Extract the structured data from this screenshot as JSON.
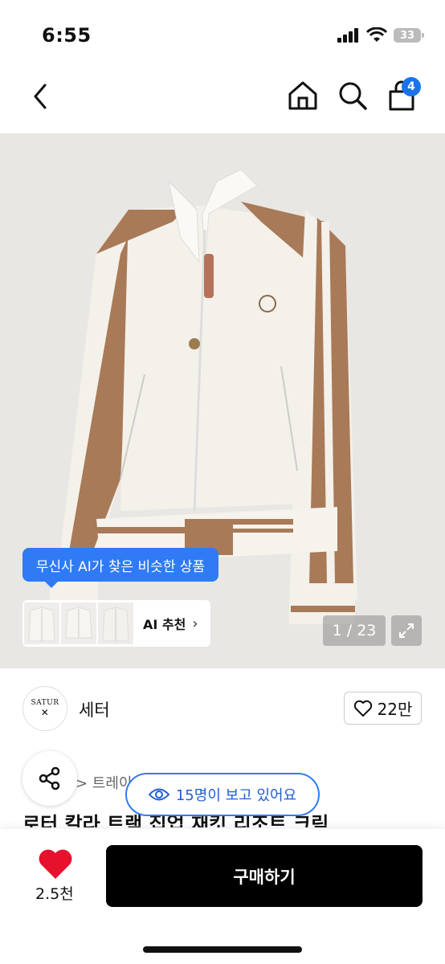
{
  "status": {
    "time": "6:55",
    "battery": "33"
  },
  "header": {
    "cart_count": "4"
  },
  "gallery": {
    "ai_tooltip": "무신사 AI가 찾은 비슷한 상품",
    "ai_label": "AI 추천",
    "pager": "1 / 23"
  },
  "brand": {
    "logo_text": "SATUR",
    "name": "세터",
    "likes": "22만"
  },
  "product": {
    "breadcrumb": "> 트레이",
    "viewers": "15명이 보고 있어요",
    "title_peek": "로터 칼라 트랙 집업 재킷 리조트 크림"
  },
  "bottom": {
    "fav_count": "2.5천",
    "buy_label": "구매하기"
  },
  "colors": {
    "accent": "#2f7bf5",
    "heart": "#e8112d",
    "jacket_trim": "#a87a58",
    "jacket_body": "#f4f1ea"
  }
}
